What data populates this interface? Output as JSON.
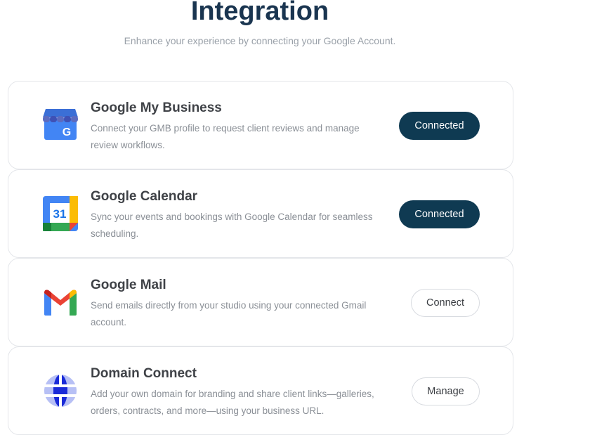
{
  "header": {
    "title": "Integration",
    "subtitle": "Enhance your experience by connecting your Google Account."
  },
  "integrations": [
    {
      "title": "Google My Business",
      "description": "Connect your GMB profile to request client reviews and manage review workflows.",
      "button_label": "Connected",
      "icon": "google-my-business-icon"
    },
    {
      "title": "Google Calendar",
      "description": "Sync your events and bookings with Google Calendar for seamless scheduling.",
      "button_label": "Connected",
      "icon": "google-calendar-icon",
      "icon_text": "31"
    },
    {
      "title": "Google Mail",
      "description": "Send emails directly from your studio using your connected Gmail account.",
      "button_label": "Connect",
      "icon": "gmail-icon"
    },
    {
      "title": "Domain Connect",
      "description": "Add your own domain for branding and share client links—galleries, orders, contracts, and more—using your business URL.",
      "button_label": "Manage",
      "icon": "globe-icon"
    }
  ],
  "colors": {
    "title": "#1a3550",
    "connected_button": "#0f3a52",
    "subtitle": "#9aa1a9"
  }
}
